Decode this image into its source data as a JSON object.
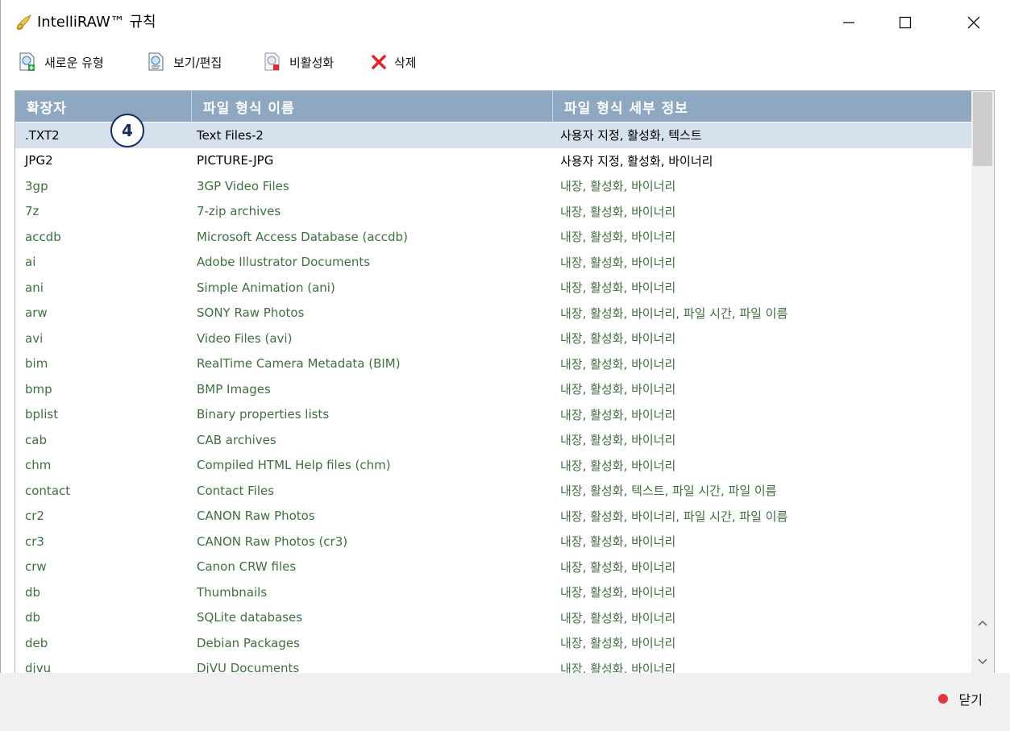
{
  "window": {
    "title": "IntelliRAW™ 규칙",
    "minimize_glyph": "—",
    "maximize_glyph": "☐",
    "close_glyph": "✕"
  },
  "toolbar": {
    "new_type": "새로운 유형",
    "view_edit": "보기/편집",
    "deactivate": "비활성화",
    "delete": "삭제"
  },
  "table": {
    "headers": [
      "확장자",
      "파일 형식 이름",
      "파일 형식 세부 정보"
    ],
    "rows": [
      {
        "ext": ".TXT2",
        "name": "Text Files-2",
        "details": "사용자 지정, 활성화, 텍스트",
        "custom": true,
        "selected": true
      },
      {
        "ext": "JPG2",
        "name": "PICTURE-JPG",
        "details": "사용자 지정, 활성화, 바이너리",
        "custom": true
      },
      {
        "ext": "3gp",
        "name": "3GP Video Files",
        "details": "내장, 활성화, 바이너리"
      },
      {
        "ext": "7z",
        "name": "7-zip archives",
        "details": "내장, 활성화, 바이너리"
      },
      {
        "ext": "accdb",
        "name": "Microsoft Access Database (accdb)",
        "details": "내장, 활성화, 바이너리"
      },
      {
        "ext": "ai",
        "name": "Adobe Illustrator Documents",
        "details": "내장, 활성화, 바이너리"
      },
      {
        "ext": "ani",
        "name": "Simple Animation (ani)",
        "details": "내장, 활성화, 바이너리"
      },
      {
        "ext": "arw",
        "name": "SONY Raw Photos",
        "details": "내장, 활성화, 바이너리, 파일 시간, 파일 이름"
      },
      {
        "ext": "avi",
        "name": "Video Files (avi)",
        "details": "내장, 활성화, 바이너리"
      },
      {
        "ext": "bim",
        "name": "RealTime Camera Metadata (BIM)",
        "details": "내장, 활성화, 바이너리"
      },
      {
        "ext": "bmp",
        "name": "BMP Images",
        "details": "내장, 활성화, 바이너리"
      },
      {
        "ext": "bplist",
        "name": "Binary properties lists",
        "details": "내장, 활성화, 바이너리"
      },
      {
        "ext": "cab",
        "name": "CAB archives",
        "details": "내장, 활성화, 바이너리"
      },
      {
        "ext": "chm",
        "name": "Compiled HTML Help files (chm)",
        "details": "내장, 활성화, 바이너리"
      },
      {
        "ext": "contact",
        "name": "Contact Files",
        "details": "내장, 활성화, 텍스트, 파일 시간, 파일 이름"
      },
      {
        "ext": "cr2",
        "name": "CANON Raw Photos",
        "details": "내장, 활성화, 바이너리, 파일 시간, 파일 이름"
      },
      {
        "ext": "cr3",
        "name": "CANON Raw Photos (cr3)",
        "details": "내장, 활성화, 바이너리"
      },
      {
        "ext": "crw",
        "name": "Canon CRW files",
        "details": "내장, 활성화, 바이너리"
      },
      {
        "ext": "db",
        "name": "Thumbnails",
        "details": "내장, 활성화, 바이너리"
      },
      {
        "ext": "db",
        "name": "SQLite databases",
        "details": "내장, 활성화, 바이너리"
      },
      {
        "ext": "deb",
        "name": "Debian Packages",
        "details": "내장, 활성화, 바이너리"
      },
      {
        "ext": "djvu",
        "name": "DjVU Documents",
        "details": "내장, 활성화, 바이너리"
      }
    ]
  },
  "badge": "4",
  "footer": {
    "close_label": "닫기"
  },
  "colors": {
    "header_bg": "#8fa8c2",
    "selected_row": "#d5e1ec",
    "builtin_text": "#3f6f3f",
    "custom_text": "#000000",
    "delete_red": "#e8202a"
  }
}
